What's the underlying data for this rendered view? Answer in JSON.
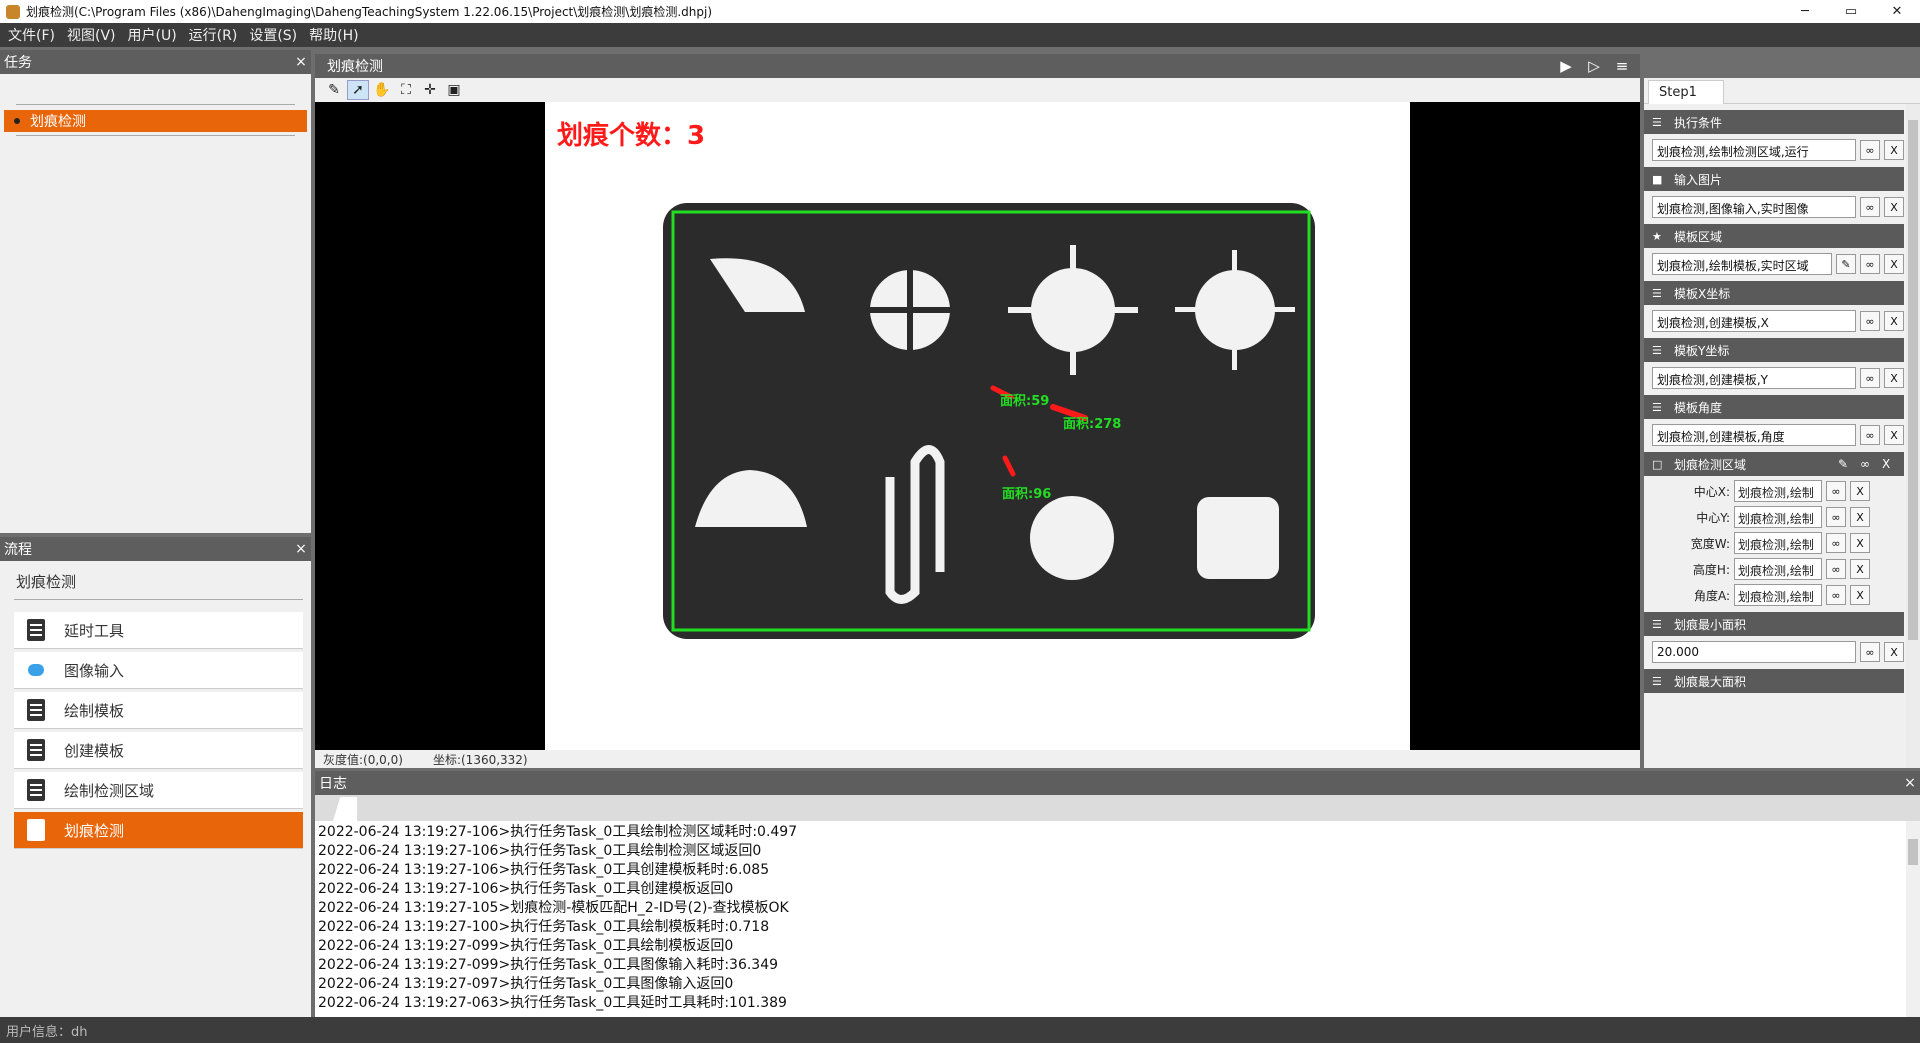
{
  "window": {
    "title": "划痕检测(C:\\Program Files (x86)\\DahengImaging\\DahengTeachingSystem 1.22.06.15\\Project\\划痕检测\\划痕检测.dhpj)",
    "minimize": "─",
    "maximize": "▭",
    "close": "✕"
  },
  "menu": [
    "文件(F)",
    "视图(V)",
    "用户(U)",
    "运行(R)",
    "设置(S)",
    "帮助(H)"
  ],
  "task_panel": {
    "title": "任务",
    "close": "×",
    "items": [
      "划痕检测"
    ]
  },
  "flow_panel": {
    "title": "流程",
    "close": "×",
    "task_name": "划痕检测",
    "items": [
      "延时工具",
      "图像输入",
      "绘制模板",
      "创建模板",
      "绘制检测区域",
      "划痕检测"
    ]
  },
  "main": {
    "tab_label": "划痕检测",
    "overlay_count": "划痕个数：3",
    "labels": [
      "面积:59",
      "面积:278",
      "面积:96"
    ],
    "status_gray": "灰度值:(0,0,0)",
    "status_coord": "坐标:(1360,332)"
  },
  "props": {
    "tab": "Step1",
    "sections": [
      {
        "title": "执行条件",
        "icon": "☰",
        "value": "划痕检测,绘制检测区域,运行"
      },
      {
        "title": "输入图片",
        "icon": "■",
        "value": "划痕检测,图像输入,实时图像"
      },
      {
        "title": "模板区域",
        "icon": "★",
        "value": "划痕检测,绘制模板,实时区域"
      },
      {
        "title": "模板X坐标",
        "icon": "☰",
        "value": "划痕检测,创建模板,X"
      },
      {
        "title": "模板Y坐标",
        "icon": "☰",
        "value": "划痕检测,创建模板,Y"
      },
      {
        "title": "模板角度",
        "icon": "☰",
        "value": "划痕检测,创建模板,角度"
      }
    ],
    "region_section": {
      "title": "划痕检测区域",
      "icon": "□",
      "rows": [
        {
          "label": "中心X:",
          "value": "划痕检测,绘制"
        },
        {
          "label": "中心Y:",
          "value": "划痕检测,绘制"
        },
        {
          "label": "宽度W:",
          "value": "划痕检测,绘制"
        },
        {
          "label": "高度H:",
          "value": "划痕检测,绘制"
        },
        {
          "label": "角度A:",
          "value": "划痕检测,绘制"
        }
      ]
    },
    "min_area": {
      "title": "划痕最小面积",
      "value": "20.000"
    },
    "max_area": {
      "title": "划痕最大面积"
    },
    "link_btn": "∞",
    "clear_btn": "X"
  },
  "log": {
    "title": "日志",
    "close": "×",
    "lines": [
      "2022-06-24 13:19:27-106>执行任务Task_0工具绘制检测区域耗时:0.497",
      "2022-06-24 13:19:27-106>执行任务Task_0工具绘制检测区域返回0",
      "2022-06-24 13:19:27-106>执行任务Task_0工具创建模板耗时:6.085",
      "2022-06-24 13:19:27-106>执行任务Task_0工具创建模板返回0",
      "2022-06-24 13:19:27-105>划痕检测-模板匹配H_2-ID号(2)-查找模板OK",
      "2022-06-24 13:19:27-100>执行任务Task_0工具绘制模板耗时:0.718",
      "2022-06-24 13:19:27-099>执行任务Task_0工具绘制模板返回0",
      "2022-06-24 13:19:27-099>执行任务Task_0工具图像输入耗时:36.349",
      "2022-06-24 13:19:27-097>执行任务Task_0工具图像输入返回0",
      "2022-06-24 13:19:27-063>执行任务Task_0工具延时工具耗时:101.389"
    ]
  },
  "user_info": "用户信息：dh",
  "colors": {
    "accent": "#e8650a",
    "overlay_red": "#ff1a1a",
    "overlay_green": "#22dd22"
  }
}
